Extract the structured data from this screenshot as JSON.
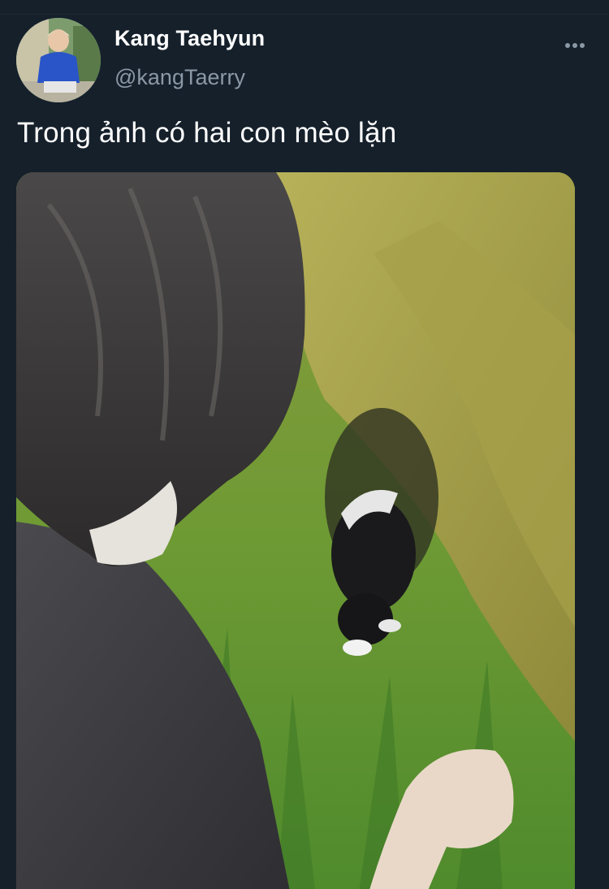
{
  "tweet": {
    "author_name": "Kang Taehyun",
    "author_handle": "@kangTaerry",
    "text": "Trong ảnh có hai con mèo lặn",
    "more_icon": "more-horizontal-icon"
  },
  "colors": {
    "background": "#15202b",
    "name": "#ffffff",
    "handle": "#8b98a5",
    "text": "#ffffff"
  }
}
